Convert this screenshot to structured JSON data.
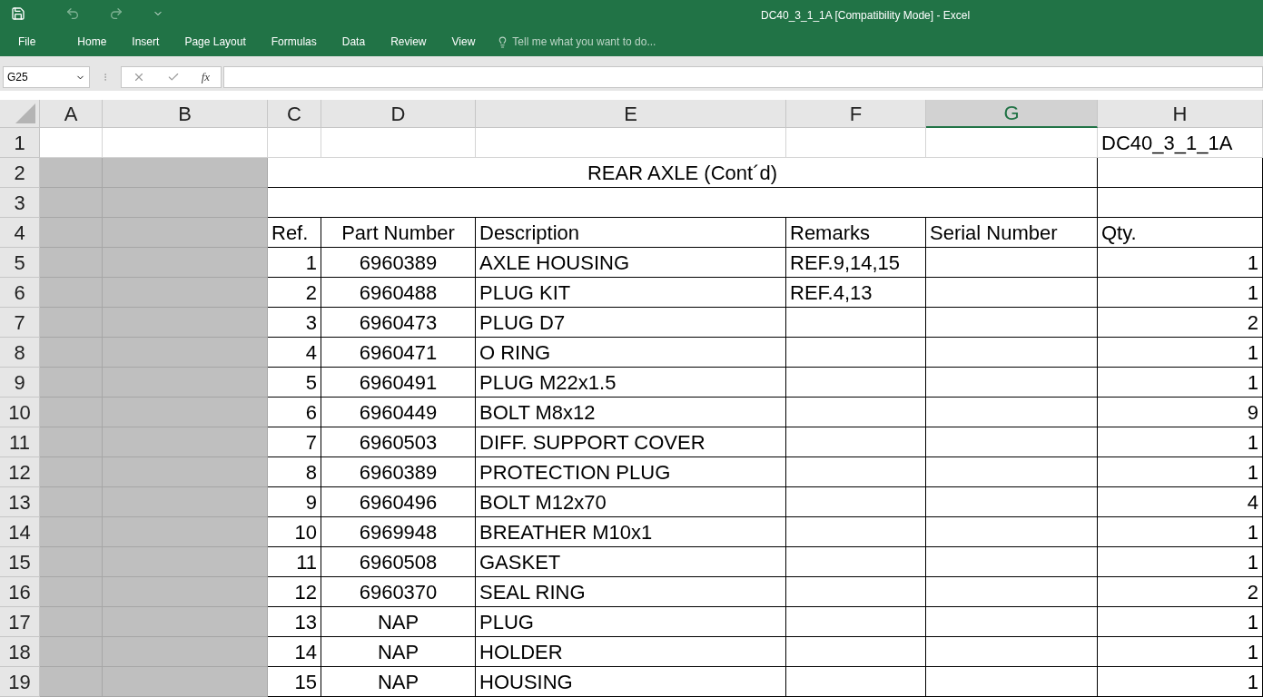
{
  "window": {
    "title": "DC40_3_1_1A  [Compatibility Mode] - Excel"
  },
  "ribbon_tabs": [
    {
      "label": "File",
      "selected": false
    },
    {
      "label": "Home",
      "selected": false
    },
    {
      "label": "Insert",
      "selected": false
    },
    {
      "label": "Page Layout",
      "selected": false
    },
    {
      "label": "Formulas",
      "selected": false
    },
    {
      "label": "Data",
      "selected": false
    },
    {
      "label": "Review",
      "selected": false
    },
    {
      "label": "View",
      "selected": false
    }
  ],
  "tell_me": {
    "placeholder": "Tell me what you want to do..."
  },
  "formula_bar": {
    "name_box": "G25",
    "fx": "fx"
  },
  "columns": [
    {
      "label": "A",
      "selected": false
    },
    {
      "label": "B",
      "selected": false
    },
    {
      "label": "C",
      "selected": false
    },
    {
      "label": "D",
      "selected": false
    },
    {
      "label": "E",
      "selected": false
    },
    {
      "label": "F",
      "selected": false
    },
    {
      "label": "G",
      "selected": true
    },
    {
      "label": "H",
      "selected": false
    }
  ],
  "rows": [
    {
      "number": "1",
      "kind": "doc_id",
      "shaded": false,
      "text": "DC40_3_1_1A"
    },
    {
      "number": "2",
      "kind": "title",
      "shaded": true,
      "text": "REAR AXLE (Cont´d)"
    },
    {
      "number": "3",
      "kind": "blank",
      "shaded": true
    },
    {
      "number": "4",
      "kind": "header",
      "shaded": true,
      "ref": "Ref.",
      "part_number": "Part Number",
      "description": "Description",
      "remarks": "Remarks",
      "serial_number": "Serial Number",
      "qty": "Qty."
    },
    {
      "number": "5",
      "kind": "item",
      "shaded": true,
      "ref": "1",
      "part_number": "6960389",
      "description": "AXLE HOUSING",
      "remarks": "REF.9,14,15",
      "qty": "1"
    },
    {
      "number": "6",
      "kind": "item",
      "shaded": true,
      "ref": "2",
      "part_number": "6960488",
      "description": "PLUG KIT",
      "remarks": "REF.4,13",
      "qty": "1"
    },
    {
      "number": "7",
      "kind": "item",
      "shaded": true,
      "ref": "3",
      "part_number": "6960473",
      "description": "PLUG D7",
      "qty": "2"
    },
    {
      "number": "8",
      "kind": "item",
      "shaded": true,
      "ref": "4",
      "part_number": "6960471",
      "description": "O RING",
      "qty": "1"
    },
    {
      "number": "9",
      "kind": "item",
      "shaded": true,
      "ref": "5",
      "part_number": "6960491",
      "description": "PLUG M22x1.5",
      "qty": "1"
    },
    {
      "number": "10",
      "kind": "item",
      "shaded": true,
      "ref": "6",
      "part_number": "6960449",
      "description": "BOLT M8x12",
      "qty": "9"
    },
    {
      "number": "11",
      "kind": "item",
      "shaded": true,
      "ref": "7",
      "part_number": "6960503",
      "description": "DIFF. SUPPORT COVER",
      "qty": "1"
    },
    {
      "number": "12",
      "kind": "item",
      "shaded": true,
      "ref": "8",
      "part_number": "6960389",
      "description": "PROTECTION PLUG",
      "qty": "1"
    },
    {
      "number": "13",
      "kind": "item",
      "shaded": true,
      "ref": "9",
      "part_number": "6960496",
      "description": "BOLT M12x70",
      "qty": "4"
    },
    {
      "number": "14",
      "kind": "item",
      "shaded": true,
      "ref": "10",
      "part_number": "6969948",
      "description": "BREATHER M10x1",
      "qty": "1"
    },
    {
      "number": "15",
      "kind": "item",
      "shaded": true,
      "ref": "11",
      "part_number": "6960508",
      "description": "GASKET",
      "qty": "1"
    },
    {
      "number": "16",
      "kind": "item",
      "shaded": true,
      "ref": "12",
      "part_number": "6960370",
      "description": "SEAL RING",
      "qty": "2"
    },
    {
      "number": "17",
      "kind": "item",
      "shaded": true,
      "ref": "13",
      "part_number": "NAP",
      "description": "PLUG",
      "qty": "1"
    },
    {
      "number": "18",
      "kind": "item",
      "shaded": true,
      "ref": "14",
      "part_number": "NAP",
      "description": "HOLDER",
      "qty": "1"
    },
    {
      "number": "19",
      "kind": "item",
      "shaded": true,
      "ref": "15",
      "part_number": "NAP",
      "description": "HOUSING",
      "qty": "1"
    }
  ]
}
